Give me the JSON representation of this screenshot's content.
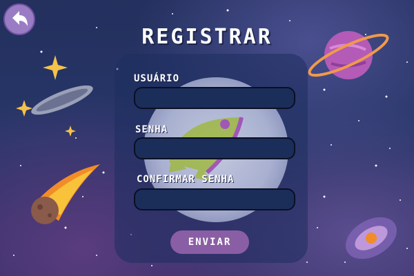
{
  "screen": {
    "title": "REGISTRAR",
    "back_icon": "back-arrow-icon"
  },
  "form": {
    "username_label": "USUÁRIO",
    "username_value": "",
    "password_label": "SENHA",
    "password_value": "",
    "confirm_label": "CONFIRMAR SENHA",
    "confirm_value": "",
    "submit_label": "ENVIAR"
  },
  "colors": {
    "accent": "#8a5ea4",
    "field_bg": "#1b2e5a",
    "background": "#263668"
  }
}
